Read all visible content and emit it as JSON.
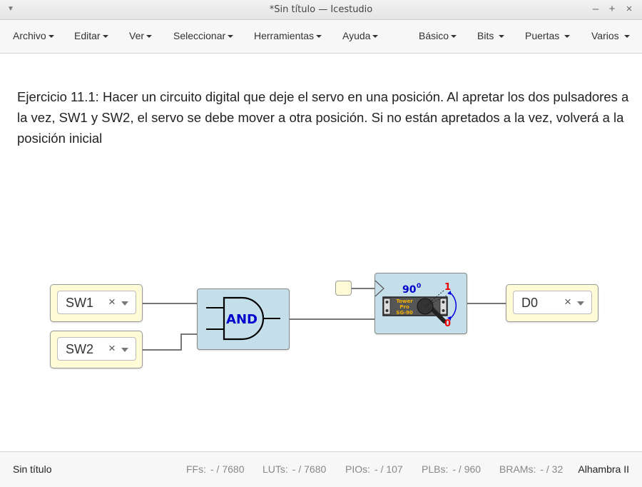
{
  "window": {
    "title": "*Sin título — Icestudio"
  },
  "menubar": {
    "left": [
      "Archivo",
      "Editar",
      "Ver",
      "Seleccionar",
      "Herramientas",
      "Ayuda"
    ],
    "right": [
      "Básico",
      "Bits",
      "Puertas",
      "Varios"
    ]
  },
  "canvas": {
    "info_text": "Ejercicio 11.1: Hacer un circuito digital que deje el servo en una posición. Al apretar los dos pulsadores a la vez, SW1 y SW2, el servo se debe mover a otra posición. Si no están apretados a la vez, volverá a la posición inicial",
    "inputs": [
      {
        "label": "SW1",
        "clear": "×"
      },
      {
        "label": "SW2",
        "clear": "×"
      }
    ],
    "output": {
      "label": "D0",
      "clear": "×"
    },
    "and_gate": {
      "label": "AND"
    },
    "servo": {
      "angle": "90",
      "degree": "0",
      "pos_high": "1",
      "pos_low": "0",
      "brand": [
        "Tower",
        "Pro",
        "SG-90"
      ]
    }
  },
  "status": {
    "project": "Sin título",
    "stats": [
      {
        "label": "FFs:",
        "value": "- / 7680"
      },
      {
        "label": "LUTs:",
        "value": "- / 7680"
      },
      {
        "label": "PIOs:",
        "value": "- / 107"
      },
      {
        "label": "PLBs:",
        "value": "- / 960"
      },
      {
        "label": "BRAMs:",
        "value": "- / 32"
      }
    ],
    "board": "Alhambra II"
  }
}
